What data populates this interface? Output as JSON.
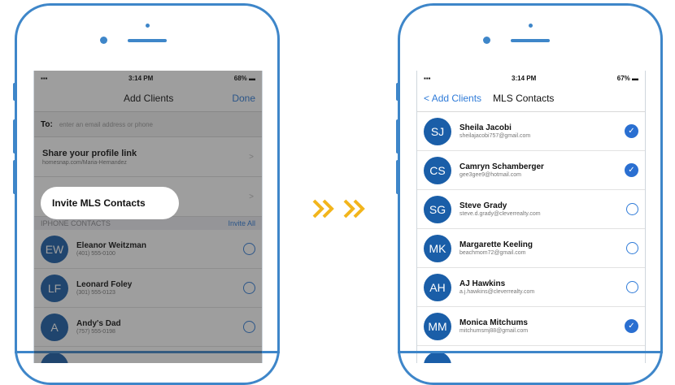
{
  "left_phone": {
    "status": {
      "time": "3:14 PM",
      "battery": "68%"
    },
    "nav": {
      "title": "Add Clients",
      "done": "Done"
    },
    "to": {
      "label": "To:",
      "placeholder": "enter an email address or phone"
    },
    "share": {
      "title": "Share your profile link",
      "subtitle": "homesnap.com/Maria-Hernandez"
    },
    "invite_mls": "Invite MLS Contacts",
    "section": {
      "title": "IPHONE CONTACTS",
      "action": "Invite All"
    },
    "contacts": [
      {
        "initials": "EW",
        "name": "Eleanor Weitzman",
        "detail": "(401) 555-0100"
      },
      {
        "initials": "LF",
        "name": "Leonard Foley",
        "detail": "(301) 555-0123"
      },
      {
        "initials": "A",
        "name": "Andy's Dad",
        "detail": "(757) 555-0198"
      }
    ]
  },
  "right_phone": {
    "status": {
      "time": "3:14 PM",
      "battery": "67%"
    },
    "nav": {
      "back": "Add Clients",
      "title": "MLS Contacts"
    },
    "contacts": [
      {
        "initials": "SJ",
        "name": "Sheila Jacobi",
        "detail": "sheilajacobi757@gmail.com",
        "selected": true
      },
      {
        "initials": "CS",
        "name": "Camryn Schamberger",
        "detail": "gee3gee9@hotmail.com",
        "selected": true
      },
      {
        "initials": "SG",
        "name": "Steve Grady",
        "detail": "steve.d.grady@cleverrealty.com",
        "selected": false
      },
      {
        "initials": "MK",
        "name": "Margarette Keeling",
        "detail": "beachmom72@gmail.com",
        "selected": false
      },
      {
        "initials": "AH",
        "name": "AJ Hawkins",
        "detail": "a.j.hawkins@cleverrealty.com",
        "selected": false
      },
      {
        "initials": "MM",
        "name": "Monica Mitchums",
        "detail": "mitchumsmj88@gmail.com",
        "selected": true
      }
    ]
  },
  "colors": {
    "frame": "#3e86c9",
    "avatar": "#1a5ea8",
    "link": "#2f7bd8",
    "arrow": "#f2b51c"
  },
  "icons": [
    "signal-icon",
    "battery-icon",
    "chevron-right-icon",
    "back-chevron-icon",
    "checkmark-icon",
    "double-chevron-arrow-icon"
  ]
}
